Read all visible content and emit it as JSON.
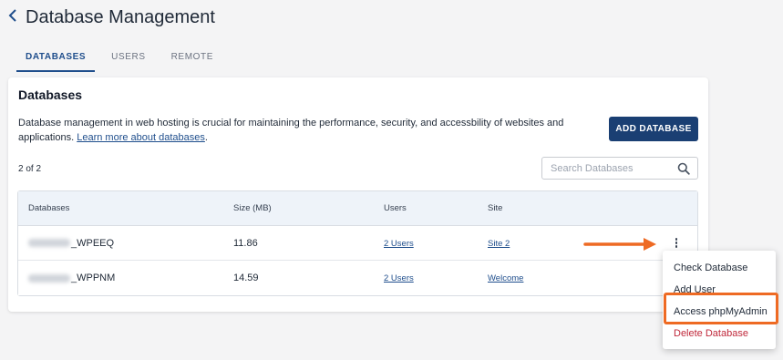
{
  "header": {
    "back_icon": "chevron-left-icon",
    "title": "Database Management"
  },
  "tabs": [
    {
      "label": "DATABASES",
      "active": true
    },
    {
      "label": "USERS",
      "active": false
    },
    {
      "label": "REMOTE",
      "active": false
    }
  ],
  "card": {
    "title": "Databases",
    "description": "Database management in web hosting is crucial for maintaining the performance, security, and accessbility of websites and applications. ",
    "learn_more": "Learn more about databases",
    "learn_more_suffix": ".",
    "add_button": "ADD DATABASE",
    "count": "2 of 2",
    "search_placeholder": "Search Databases",
    "search_icon": "search-icon"
  },
  "table": {
    "headers": [
      "Databases",
      "Size (MB)",
      "Users",
      "Site"
    ],
    "rows": [
      {
        "name_suffix": "_WPEEQ",
        "size": "11.86",
        "users": "2 Users",
        "site": "Site 2"
      },
      {
        "name_suffix": "_WPPNM",
        "size": "14.59",
        "users": "2 Users",
        "site": "Welcome"
      }
    ]
  },
  "context_menu": {
    "items": [
      "Check Database",
      "Add User",
      "Access phpMyAdmin",
      "Delete Database"
    ],
    "highlighted": "Access phpMyAdmin"
  },
  "colors": {
    "accent": "#1a3f73",
    "annotation": "#ee6a23",
    "danger": "#c0293b"
  }
}
